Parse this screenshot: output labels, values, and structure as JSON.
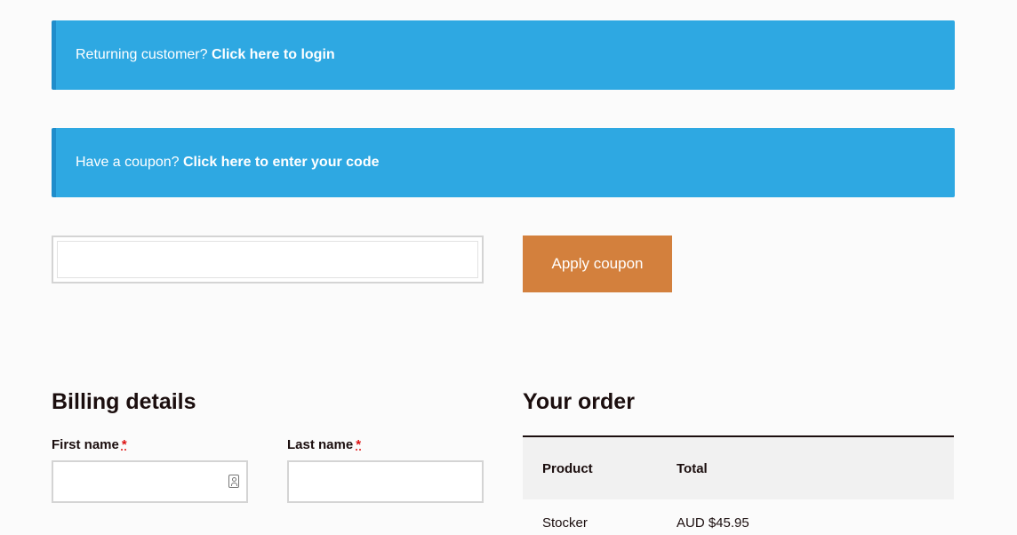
{
  "notices": {
    "login": {
      "prefix": "Returning customer? ",
      "link": "Click here to login"
    },
    "coupon": {
      "prefix": "Have a coupon? ",
      "link": "Click here to enter your code"
    }
  },
  "coupon_form": {
    "input_value": "",
    "apply_label": "Apply coupon"
  },
  "billing": {
    "title": "Billing details",
    "first_name_label": "First name",
    "last_name_label": "Last name",
    "required_mark": "*"
  },
  "order": {
    "title": "Your order",
    "columns": {
      "product": "Product",
      "total": "Total"
    },
    "rows": [
      {
        "product": "Stocker",
        "total": "AUD $45.95"
      }
    ]
  },
  "colors": {
    "notice_bg": "#2ea8e2",
    "button_bg": "#d3803d",
    "required": "#dd1111"
  },
  "icons": {
    "first_name_autofill": "contact-card-icon"
  }
}
